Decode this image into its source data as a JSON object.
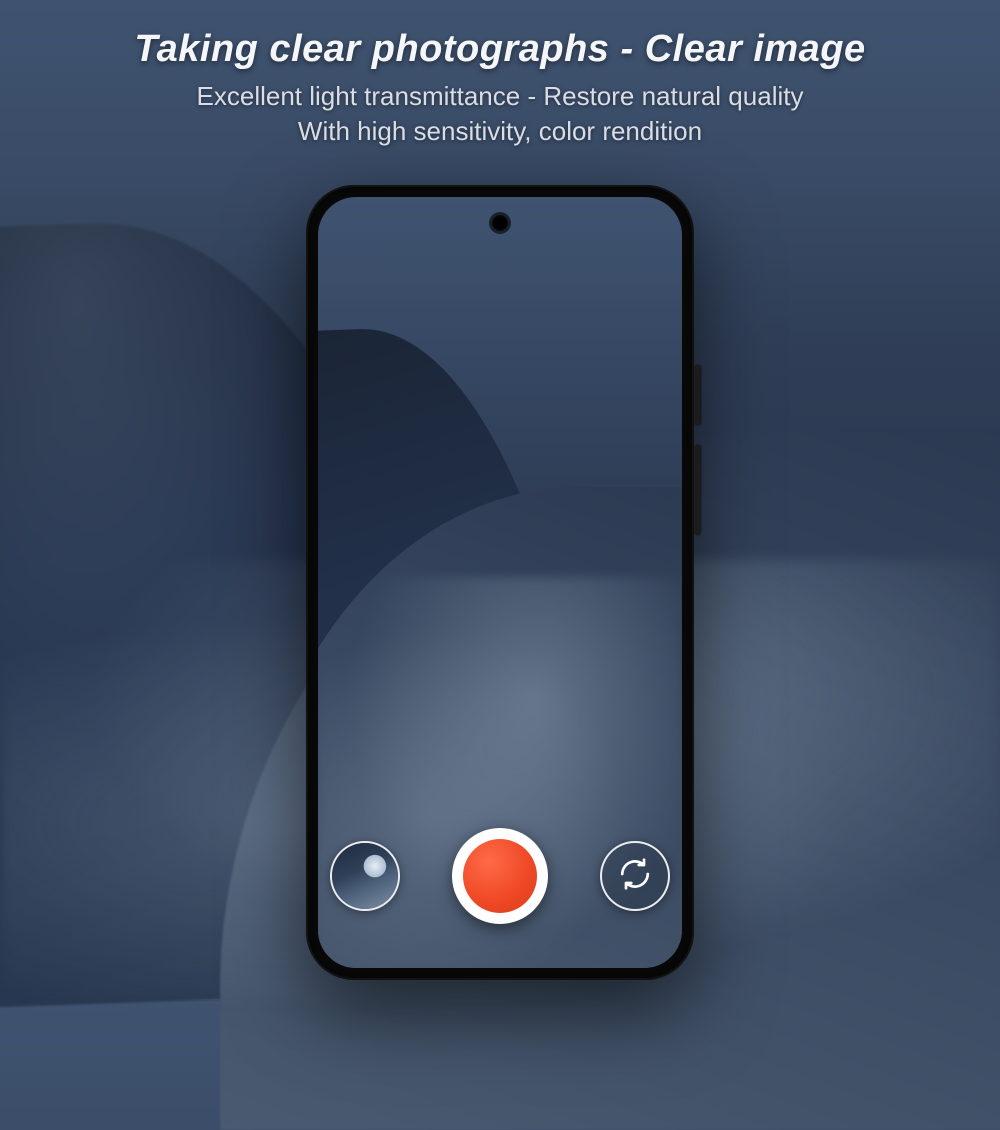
{
  "header": {
    "headline": "Taking clear photographs - Clear image",
    "sub1": "Excellent light transmittance - Restore natural quality",
    "sub2": "With high sensitivity, color rendition"
  },
  "camera": {
    "gallery_icon": "gallery-thumbnail",
    "shutter_icon": "record-shutter",
    "switch_icon": "camera-switch",
    "shutter_color": "#f04a28"
  }
}
